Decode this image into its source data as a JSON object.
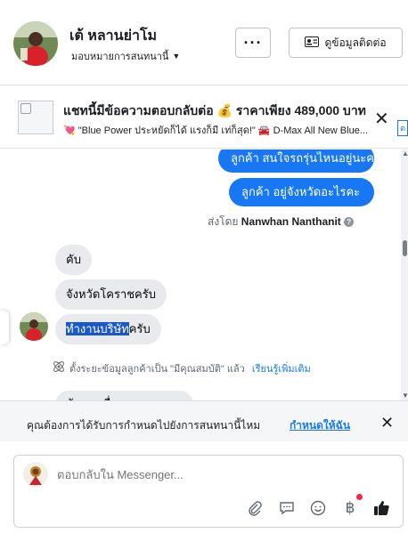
{
  "header": {
    "contact_name": "เต้ หลานย่าโม",
    "assign_label": "มอบหมายการสนทนานี้",
    "more_label": "···",
    "contact_info_label": "ดูข้อมูลติดต่อ"
  },
  "ad": {
    "title": "แชทนี้มีข้อความตอบกลับต่อ 💰 ราคาเพียง 489,000 บาท",
    "subtitle": "💘 \"Blue Power ประหยัดก็ได้ แรงก็มี เท่ก็สุด!\" 🚘 D-Max All New Blue...",
    "edge_tab": "ต"
  },
  "thread": {
    "outgoing": [
      "ลูกค้า สนใจรถรุ่นไหนอยู่นะคะ",
      "ลูกค้า  อยู่จังหวัดอะไรคะ"
    ],
    "sent_by_prefix": "ส่งโดย",
    "sent_by_name": "Nanwhan Nanthanit",
    "incoming": [
      "คับ",
      "จังหวัดโคราชครับ"
    ],
    "last_highlight": "ทำงานบริษัท",
    "last_rest": "ครับ",
    "system_text": "ตั้งระยะข้อมูลลูกค้าเป็น \"มีคุณสมบัติ\" แล้ว",
    "system_link": "เรียนรู้เพิ่มเติม",
    "cut_text": "นัดเจอเพื่อเสนอราคาและเงื่อนไข"
  },
  "prompt": {
    "text": "คุณต้องการได้รับการกำหนดไปยังการสนทนานี้ไหม",
    "link": "กำหนดให้ฉัน",
    "close": "✕"
  },
  "composer": {
    "placeholder": "ตอบกลับใน Messenger..."
  },
  "icons": {
    "attach": "paperclip-icon",
    "saved_reply": "chat-bubble-icon",
    "emoji": "smiley-icon",
    "payment": "baht-icon",
    "like": "thumbs-up-icon"
  },
  "colors": {
    "accent": "#1877f2",
    "incoming_bubble": "#e9eaee",
    "notification": "#f02849"
  }
}
